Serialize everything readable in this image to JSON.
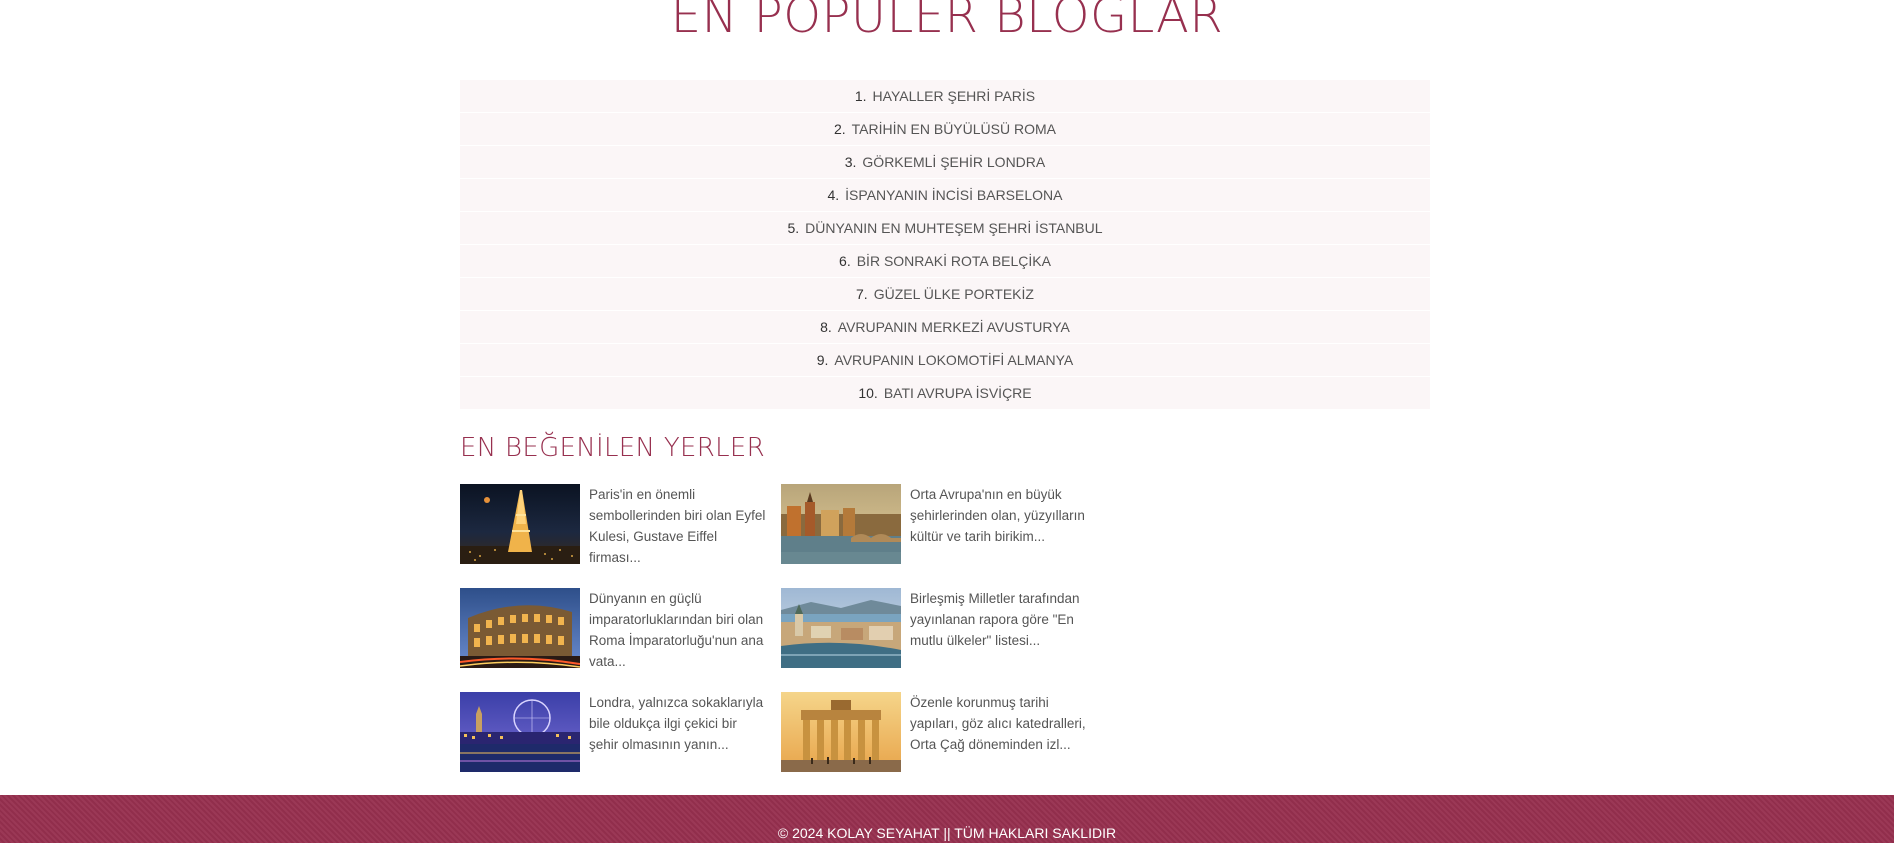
{
  "popular": {
    "title": "EN POPÜLER BLOGLAR",
    "items": [
      {
        "num": "1.",
        "label": "HAYALLER ŞEHRİ PARİS"
      },
      {
        "num": "2.",
        "label": "TARİHİN EN BÜYÜLÜSÜ ROMA"
      },
      {
        "num": "3.",
        "label": "GÖRKEMLİ ŞEHİR LONDRA"
      },
      {
        "num": "4.",
        "label": "İSPANYANIN İNCİSİ BARSELONA"
      },
      {
        "num": "5.",
        "label": "DÜNYANIN EN MUHTEŞEM ŞEHRİ İSTANBUL"
      },
      {
        "num": "6.",
        "label": "BİR SONRAKİ ROTA BELÇİKA"
      },
      {
        "num": "7.",
        "label": "GÜZEL ÜLKE PORTEKİZ"
      },
      {
        "num": "8.",
        "label": "AVRUPANIN MERKEZİ AVUSTURYA"
      },
      {
        "num": "9.",
        "label": "AVRUPANIN LOKOMOTİFİ ALMANYA"
      },
      {
        "num": "10.",
        "label": "BATI AVRUPA İSVİÇRE"
      }
    ]
  },
  "liked": {
    "title": "EN BEĞENİLEN YERLER",
    "places": [
      {
        "text": "Paris'in en önemli sembollerinden biri olan Eyfel Kulesi, Gustave Eiffel firması...",
        "image": "eiffel-tower-night"
      },
      {
        "text": "Orta Avrupa'nın en büyük şehirlerinden olan, yüzyılların kültür ve tarih birikim...",
        "image": "prague-river-autumn"
      },
      {
        "text": "Dünyanın en güçlü imparatorluklarından biri olan Roma İmparatorluğu'nun ana vata...",
        "image": "colosseum-night"
      },
      {
        "text": "Birleşmiş Milletler tarafından yayınlanan rapora göre \"En mutlu ülkeler\" listesi...",
        "image": "zurich-lake-city"
      },
      {
        "text": "Londra, yalnızca sokaklarıyla bile oldukça ilgi çekici bir şehir olmasının yanın...",
        "image": "london-eye-night"
      },
      {
        "text": "Özenle korunmuş tarihi yapıları, göz alıcı katedralleri, Orta Çağ döneminden izl...",
        "image": "brandenburg-gate"
      }
    ]
  },
  "footer": {
    "copyright": "© 2024 KOLAY SEYAHAT || TÜM HAKLARI SAKLIDIR"
  },
  "colors": {
    "accent": "#97304f",
    "list_bg": "#fbf6f7",
    "text": "#555555"
  }
}
